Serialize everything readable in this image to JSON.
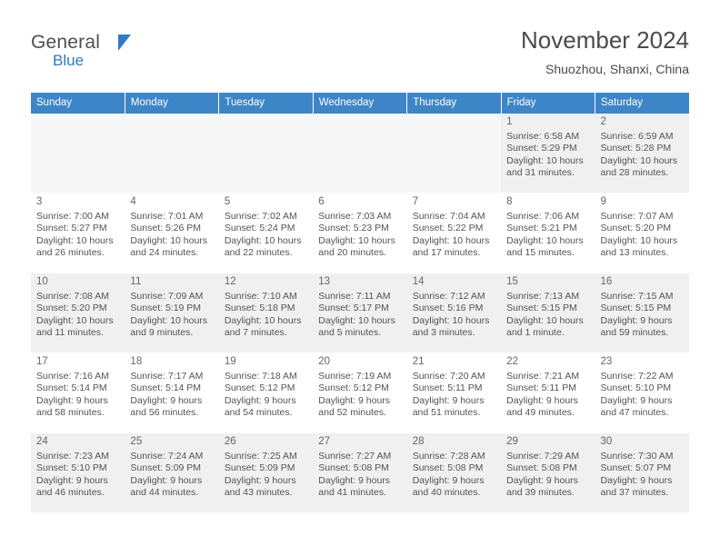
{
  "logo": {
    "line1": "General",
    "line2": "Blue",
    "accent": "#2f7bc4"
  },
  "header": {
    "title": "November 2024",
    "subtitle": "Shuozhou, Shanxi, China"
  },
  "calendar": {
    "header_bg": "#3d85c6",
    "weekdays": [
      "Sunday",
      "Monday",
      "Tuesday",
      "Wednesday",
      "Thursday",
      "Friday",
      "Saturday"
    ],
    "weeks": [
      [
        {
          "day": "",
          "info": ""
        },
        {
          "day": "",
          "info": ""
        },
        {
          "day": "",
          "info": ""
        },
        {
          "day": "",
          "info": ""
        },
        {
          "day": "",
          "info": ""
        },
        {
          "day": "1",
          "info": "Sunrise: 6:58 AM\nSunset: 5:29 PM\nDaylight: 10 hours\nand 31 minutes."
        },
        {
          "day": "2",
          "info": "Sunrise: 6:59 AM\nSunset: 5:28 PM\nDaylight: 10 hours\nand 28 minutes."
        }
      ],
      [
        {
          "day": "3",
          "info": "Sunrise: 7:00 AM\nSunset: 5:27 PM\nDaylight: 10 hours\nand 26 minutes."
        },
        {
          "day": "4",
          "info": "Sunrise: 7:01 AM\nSunset: 5:26 PM\nDaylight: 10 hours\nand 24 minutes."
        },
        {
          "day": "5",
          "info": "Sunrise: 7:02 AM\nSunset: 5:24 PM\nDaylight: 10 hours\nand 22 minutes."
        },
        {
          "day": "6",
          "info": "Sunrise: 7:03 AM\nSunset: 5:23 PM\nDaylight: 10 hours\nand 20 minutes."
        },
        {
          "day": "7",
          "info": "Sunrise: 7:04 AM\nSunset: 5:22 PM\nDaylight: 10 hours\nand 17 minutes."
        },
        {
          "day": "8",
          "info": "Sunrise: 7:06 AM\nSunset: 5:21 PM\nDaylight: 10 hours\nand 15 minutes."
        },
        {
          "day": "9",
          "info": "Sunrise: 7:07 AM\nSunset: 5:20 PM\nDaylight: 10 hours\nand 13 minutes."
        }
      ],
      [
        {
          "day": "10",
          "info": "Sunrise: 7:08 AM\nSunset: 5:20 PM\nDaylight: 10 hours\nand 11 minutes."
        },
        {
          "day": "11",
          "info": "Sunrise: 7:09 AM\nSunset: 5:19 PM\nDaylight: 10 hours\nand 9 minutes."
        },
        {
          "day": "12",
          "info": "Sunrise: 7:10 AM\nSunset: 5:18 PM\nDaylight: 10 hours\nand 7 minutes."
        },
        {
          "day": "13",
          "info": "Sunrise: 7:11 AM\nSunset: 5:17 PM\nDaylight: 10 hours\nand 5 minutes."
        },
        {
          "day": "14",
          "info": "Sunrise: 7:12 AM\nSunset: 5:16 PM\nDaylight: 10 hours\nand 3 minutes."
        },
        {
          "day": "15",
          "info": "Sunrise: 7:13 AM\nSunset: 5:15 PM\nDaylight: 10 hours\nand 1 minute."
        },
        {
          "day": "16",
          "info": "Sunrise: 7:15 AM\nSunset: 5:15 PM\nDaylight: 9 hours\nand 59 minutes."
        }
      ],
      [
        {
          "day": "17",
          "info": "Sunrise: 7:16 AM\nSunset: 5:14 PM\nDaylight: 9 hours\nand 58 minutes."
        },
        {
          "day": "18",
          "info": "Sunrise: 7:17 AM\nSunset: 5:14 PM\nDaylight: 9 hours\nand 56 minutes."
        },
        {
          "day": "19",
          "info": "Sunrise: 7:18 AM\nSunset: 5:12 PM\nDaylight: 9 hours\nand 54 minutes."
        },
        {
          "day": "20",
          "info": "Sunrise: 7:19 AM\nSunset: 5:12 PM\nDaylight: 9 hours\nand 52 minutes."
        },
        {
          "day": "21",
          "info": "Sunrise: 7:20 AM\nSunset: 5:11 PM\nDaylight: 9 hours\nand 51 minutes."
        },
        {
          "day": "22",
          "info": "Sunrise: 7:21 AM\nSunset: 5:11 PM\nDaylight: 9 hours\nand 49 minutes."
        },
        {
          "day": "23",
          "info": "Sunrise: 7:22 AM\nSunset: 5:10 PM\nDaylight: 9 hours\nand 47 minutes."
        }
      ],
      [
        {
          "day": "24",
          "info": "Sunrise: 7:23 AM\nSunset: 5:10 PM\nDaylight: 9 hours\nand 46 minutes."
        },
        {
          "day": "25",
          "info": "Sunrise: 7:24 AM\nSunset: 5:09 PM\nDaylight: 9 hours\nand 44 minutes."
        },
        {
          "day": "26",
          "info": "Sunrise: 7:25 AM\nSunset: 5:09 PM\nDaylight: 9 hours\nand 43 minutes."
        },
        {
          "day": "27",
          "info": "Sunrise: 7:27 AM\nSunset: 5:08 PM\nDaylight: 9 hours\nand 41 minutes."
        },
        {
          "day": "28",
          "info": "Sunrise: 7:28 AM\nSunset: 5:08 PM\nDaylight: 9 hours\nand 40 minutes."
        },
        {
          "day": "29",
          "info": "Sunrise: 7:29 AM\nSunset: 5:08 PM\nDaylight: 9 hours\nand 39 minutes."
        },
        {
          "day": "30",
          "info": "Sunrise: 7:30 AM\nSunset: 5:07 PM\nDaylight: 9 hours\nand 37 minutes."
        }
      ]
    ]
  }
}
